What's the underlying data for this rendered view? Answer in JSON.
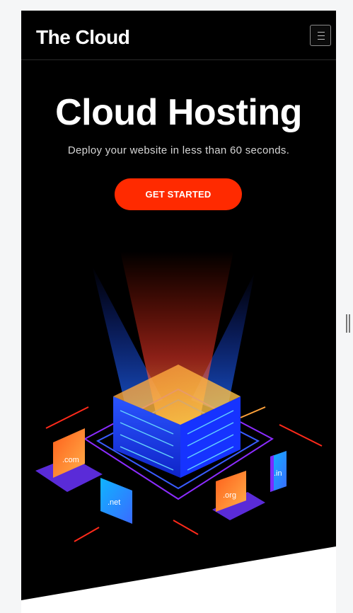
{
  "navbar": {
    "brand": "The Cloud",
    "menu_icon": "hamburger-icon"
  },
  "hero": {
    "title": "Cloud Hosting",
    "subtitle": "Deploy your website in less than 60 seconds.",
    "cta_label": "GET STARTED"
  },
  "illustration": {
    "domains": [
      ".com",
      ".net",
      ".org",
      ".in"
    ]
  },
  "colors": {
    "background": "#000000",
    "accent": "#ff2a00",
    "server_blue": "#1540ff",
    "neon_purple": "#7b2cff",
    "device_orange": "#ff7a1a"
  }
}
